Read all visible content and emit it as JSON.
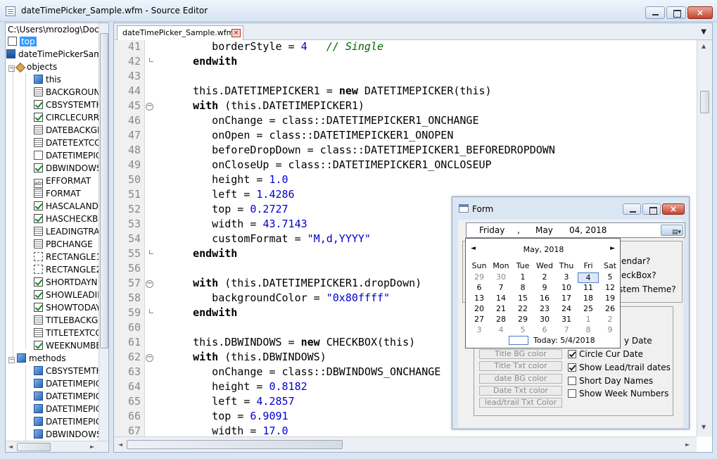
{
  "window": {
    "title": "dateTimePicker_Sample.wfm - Source Editor",
    "close": "×"
  },
  "tree": {
    "path": "C:\\Users\\mrozlog\\Docu",
    "top_label": "top",
    "file_label": "dateTimePickerSamp",
    "objects_label": "objects",
    "objects": [
      {
        "label": "this",
        "icon": "cube"
      },
      {
        "label": "BACKGROUN",
        "icon": "lines"
      },
      {
        "label": "CBSYSTEMTH",
        "icon": "chk"
      },
      {
        "label": "CIRCLECURRI",
        "icon": "chk"
      },
      {
        "label": "DATEBACKGI",
        "icon": "lines"
      },
      {
        "label": "DATETEXTCC",
        "icon": "lines"
      },
      {
        "label": "DATETIMEPIC",
        "icon": "page"
      },
      {
        "label": "DBWINDOWS",
        "icon": "chk"
      },
      {
        "label": "EFFORMAT",
        "icon": "abl"
      },
      {
        "label": "FORMAT",
        "icon": "lines"
      },
      {
        "label": "HASCALAND",
        "icon": "chk"
      },
      {
        "label": "HASCHECKB(",
        "icon": "chk"
      },
      {
        "label": "LEADINGTRA",
        "icon": "lines"
      },
      {
        "label": "PBCHANGE",
        "icon": "lines"
      },
      {
        "label": "RECTANGLE1",
        "icon": "rect"
      },
      {
        "label": "RECTANGLE2",
        "icon": "rect"
      },
      {
        "label": "SHORTDAYN",
        "icon": "chk"
      },
      {
        "label": "SHOWLEADIN",
        "icon": "chk"
      },
      {
        "label": "SHOWTODAY",
        "icon": "chk"
      },
      {
        "label": "TITLEBACKGI",
        "icon": "lines"
      },
      {
        "label": "TITLETEXTCC",
        "icon": "lines"
      },
      {
        "label": "WEEKNUMBE",
        "icon": "chk"
      }
    ],
    "methods_label": "methods",
    "methods": [
      "CBSYSTEMTH",
      "DATETIMEPIC",
      "DATETIMEPIC",
      "DATETIMEPIC",
      "DATETIMEPIC",
      "DBWINDOWS"
    ]
  },
  "editor": {
    "tab_label": "dateTimePicker_Sample.wfm",
    "tab_close": "×",
    "lines": [
      {
        "n": "41",
        "html": "      borderStyle = <span class='num'>4</span>   <span class='cmt'>// Single</span>"
      },
      {
        "n": "42",
        "html": "   <span class='kw'>endwith</span>"
      },
      {
        "n": "43",
        "html": ""
      },
      {
        "n": "44",
        "html": "   this.DATETIMEPICKER1 = <span class='kw'>new</span> DATETIMEPICKER(this)"
      },
      {
        "n": "45",
        "html": "   <span class='kw'>with</span> (this.DATETIMEPICKER1)"
      },
      {
        "n": "46",
        "html": "      onChange = class::DATETIMEPICKER1_ONCHANGE"
      },
      {
        "n": "47",
        "html": "      onOpen = class::DATETIMEPICKER1_ONOPEN"
      },
      {
        "n": "48",
        "html": "      beforeDropDown = class::DATETIMEPICKER1_BEFOREDROPDOWN"
      },
      {
        "n": "49",
        "html": "      onCloseUp = class::DATETIMEPICKER1_ONCLOSEUP"
      },
      {
        "n": "50",
        "html": "      height = <span class='num'>1.0</span>"
      },
      {
        "n": "51",
        "html": "      left = <span class='num'>1.4286</span>"
      },
      {
        "n": "52",
        "html": "      top = <span class='num'>0.2727</span>"
      },
      {
        "n": "53",
        "html": "      width = <span class='num'>43.7143</span>"
      },
      {
        "n": "54",
        "html": "      customFormat = <span class='str'>\"M,d,YYYY\"</span>"
      },
      {
        "n": "55",
        "html": "   <span class='kw'>endwith</span>"
      },
      {
        "n": "56",
        "html": ""
      },
      {
        "n": "57",
        "html": "   <span class='kw'>with</span> (this.DATETIMEPICKER1.dropDown)"
      },
      {
        "n": "58",
        "html": "      backgroundColor = <span class='str'>\"0x80ffff\"</span>"
      },
      {
        "n": "59",
        "html": "   <span class='kw'>endwith</span>"
      },
      {
        "n": "60",
        "html": ""
      },
      {
        "n": "61",
        "html": "   this.DBWINDOWS = <span class='kw'>new</span> CHECKBOX(this)"
      },
      {
        "n": "62",
        "html": "   <span class='kw'>with</span> (this.DBWINDOWS)"
      },
      {
        "n": "63",
        "html": "      onChange = class::DBWINDOWS_ONCHANGE"
      },
      {
        "n": "64",
        "html": "      height = <span class='num'>0.8182</span>"
      },
      {
        "n": "65",
        "html": "      left = <span class='num'>4.2857</span>"
      },
      {
        "n": "66",
        "html": "      top = <span class='num'>6.9091</span>"
      },
      {
        "n": "67",
        "html": "      width = <span class='num'>17.0</span>"
      }
    ],
    "fold_open": [
      "45",
      "57",
      "62"
    ],
    "fold_end": [
      "42",
      "55",
      "59"
    ]
  },
  "form": {
    "title": "Form",
    "close": "×",
    "dtp": {
      "day": "Friday",
      "sep": ",",
      "month": "May",
      "date": "04, 2018"
    },
    "partial_labels": [
      "endar?",
      "eckBox?",
      "stem Theme?"
    ],
    "partial_label2": "y Date",
    "buttons": [
      "Title BG color",
      "Title Txt color",
      "date BG color",
      "Date Txt color",
      "lead/trail Txt Color"
    ],
    "checks": [
      {
        "label": "Circle Cur Date",
        "checked": true
      },
      {
        "label": "Show Lead/trail dates",
        "checked": true
      },
      {
        "label": "Short Day Names",
        "checked": false
      },
      {
        "label": "Show Week Numbers",
        "checked": false
      }
    ]
  },
  "calendar": {
    "header": "May, 2018",
    "prev": "◄",
    "next": "►",
    "dow": [
      "Sun",
      "Mon",
      "Tue",
      "Wed",
      "Thu",
      "Fri",
      "Sat"
    ],
    "weeks": [
      [
        "29",
        "30",
        "1",
        "2",
        "3",
        "4",
        "5"
      ],
      [
        "6",
        "7",
        "8",
        "9",
        "10",
        "11",
        "12"
      ],
      [
        "13",
        "14",
        "15",
        "16",
        "17",
        "18",
        "19"
      ],
      [
        "20",
        "21",
        "22",
        "23",
        "24",
        "25",
        "26"
      ],
      [
        "27",
        "28",
        "29",
        "30",
        "31",
        "1",
        "2"
      ],
      [
        "3",
        "4",
        "5",
        "6",
        "7",
        "8",
        "9"
      ]
    ],
    "gray": [
      [
        0,
        0
      ],
      [
        0,
        1
      ],
      [
        4,
        5
      ],
      [
        4,
        6
      ],
      [
        5,
        0
      ],
      [
        5,
        1
      ],
      [
        5,
        2
      ],
      [
        5,
        3
      ],
      [
        5,
        4
      ],
      [
        5,
        5
      ],
      [
        5,
        6
      ]
    ],
    "selected": [
      0,
      5
    ],
    "today_label": "Today: 5/4/2018"
  }
}
